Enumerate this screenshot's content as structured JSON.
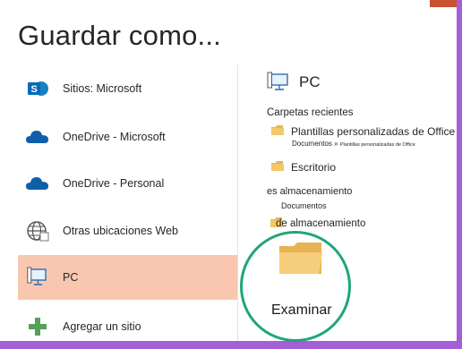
{
  "title": "Guardar como...",
  "locations": [
    {
      "label": "Sitios: Microsoft",
      "icon": "sharepoint-icon"
    },
    {
      "label": "OneDrive - Microsoft",
      "icon": "onedrive-cloud-icon"
    },
    {
      "label": "OneDrive - Personal",
      "icon": "onedrive-cloud-icon"
    },
    {
      "label": "Otras ubicaciones Web",
      "icon": "globe-icon"
    },
    {
      "label": "PC",
      "icon": "pc-monitor-icon",
      "selected": true
    },
    {
      "label": "Agregar un sitio",
      "icon": "plus-icon"
    }
  ],
  "right": {
    "heading": "PC",
    "recent_label": "Carpetas recientes",
    "folders": [
      {
        "name": "Plantillas personalizadas de Office",
        "path_prefix": "Documentos »",
        "path_rest": "Plantillas personalizadas de Office"
      },
      {
        "name": "Escritorio"
      },
      {
        "name": "es almacenamiento",
        "path": "Documentos"
      },
      {
        "name": "de almacenamiento"
      }
    ],
    "browse_label": "Examinar"
  },
  "colors": {
    "accent_border": "#a25fd6",
    "selected_bg": "#f9c7b0",
    "highlight_circle": "#1fa67a"
  }
}
